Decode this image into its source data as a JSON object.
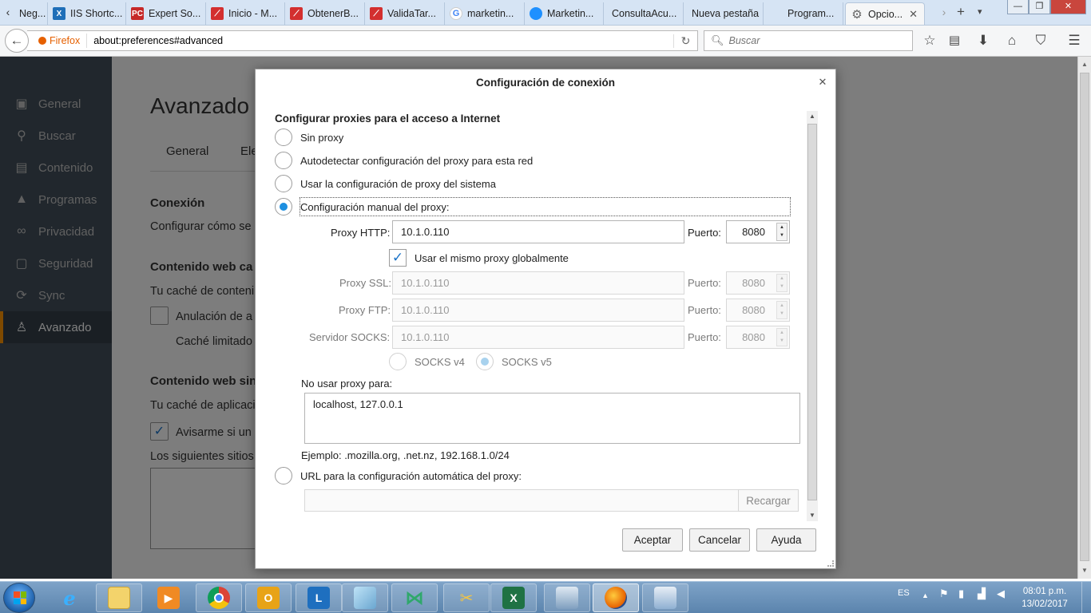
{
  "browser": {
    "tabs": [
      {
        "title": "Neg...",
        "icon": "blank-icon"
      },
      {
        "title": "IIS Shortc...",
        "icon": "iis-icon"
      },
      {
        "title": "Expert So...",
        "icon": "pc-icon"
      },
      {
        "title": "Inicio - M...",
        "icon": "app-red-icon"
      },
      {
        "title": "ObtenerB...",
        "icon": "app-red-icon"
      },
      {
        "title": "ValidaTar...",
        "icon": "app-red-icon"
      },
      {
        "title": "marketin...",
        "icon": "google-icon"
      },
      {
        "title": "Marketin...",
        "icon": "cloud-icon"
      },
      {
        "title": "ConsultaAcu...",
        "icon": "blank-icon"
      },
      {
        "title": "Nueva pestaña",
        "icon": "blank-icon"
      },
      {
        "title": "Program...",
        "icon": "blank-icon"
      },
      {
        "title": "Opcio...",
        "icon": "gear-icon",
        "active": true
      }
    ],
    "identity_label": "Firefox",
    "url": "about:preferences#advanced",
    "search_placeholder": "Buscar"
  },
  "prefs": {
    "sidebar": [
      {
        "label": "General",
        "icon": "general-icon"
      },
      {
        "label": "Buscar",
        "icon": "search-icon"
      },
      {
        "label": "Contenido",
        "icon": "content-icon"
      },
      {
        "label": "Programas",
        "icon": "applications-icon"
      },
      {
        "label": "Privacidad",
        "icon": "mask-icon"
      },
      {
        "label": "Seguridad",
        "icon": "lock-icon"
      },
      {
        "label": "Sync",
        "icon": "sync-icon"
      },
      {
        "label": "Avanzado",
        "icon": "wizard-hat-icon",
        "selected": true
      }
    ],
    "title": "Avanzado",
    "subtab_general": "General",
    "subtab_partial": "Ele",
    "connection_heading": "Conexión",
    "connection_text": "Configurar cómo se",
    "web_content_heading": "Contenido web ca",
    "web_content_text": "Tu caché de conteni",
    "override_label": "Anulación de a",
    "cache_limit_label": "Caché limitado",
    "offline_heading": "Contenido web sin",
    "offline_text": "Tu caché de aplicaci",
    "notify_label": "Avisarme si un",
    "following_sites": "Los siguientes sitios"
  },
  "dialog": {
    "title": "Configuración de conexión",
    "section_heading": "Configurar proxies para el acceso a Internet",
    "options": {
      "no_proxy": "Sin proxy",
      "autodetect": "Autodetectar configuración del proxy para esta red",
      "system": "Usar la configuración de proxy del sistema",
      "manual": "Configuración manual del proxy:",
      "auto_url": "URL para la configuración automática del proxy:"
    },
    "http_label": "Proxy HTTP:",
    "http_value": "10.1.0.110",
    "port_label": "Puerto:",
    "http_port": "8080",
    "same_proxy_label": "Usar el mismo proxy globalmente",
    "ssl_label": "Proxy SSL:",
    "ssl_value": "10.1.0.110",
    "ssl_port": "8080",
    "ftp_label": "Proxy FTP:",
    "ftp_value": "10.1.0.110",
    "ftp_port": "8080",
    "socks_label": "Servidor SOCKS:",
    "socks_value": "10.1.0.110",
    "socks_port": "8080",
    "socks_v4": "SOCKS v4",
    "socks_v5": "SOCKS v5",
    "no_proxy_for_label": "No usar proxy para:",
    "no_proxy_for_value": "localhost, 127.0.0.1",
    "example": "Ejemplo: .mozilla.org, .net.nz, 192.168.1.0/24",
    "reload_button": "Recargar",
    "ok_button": "Aceptar",
    "cancel_button": "Cancelar",
    "help_button": "Ayuda"
  },
  "taskbar": {
    "language": "ES",
    "time": "08:01 p.m.",
    "date": "13/02/2017"
  }
}
